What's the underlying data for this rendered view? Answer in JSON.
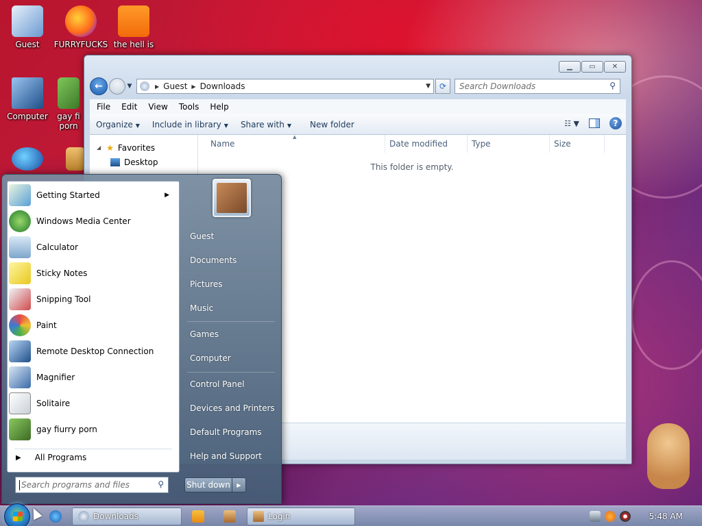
{
  "desktop": {
    "icons": [
      {
        "label": "Guest"
      },
      {
        "label": "FURRYFUCKS"
      },
      {
        "label": "the hell is"
      },
      {
        "label": "Computer"
      },
      {
        "label": "gay fi"
      },
      {
        "label": "porn"
      }
    ]
  },
  "explorer": {
    "breadcrumb": [
      "Guest",
      "Downloads"
    ],
    "search_placeholder": "Search Downloads",
    "menu": [
      "File",
      "Edit",
      "View",
      "Tools",
      "Help"
    ],
    "commands": {
      "organize": "Organize",
      "include_in_library": "Include in library",
      "share_with": "Share with",
      "new_folder": "New folder"
    },
    "nav": {
      "favorites": "Favorites",
      "desktop": "Desktop"
    },
    "columns": [
      "Name",
      "Date modified",
      "Type",
      "Size"
    ],
    "empty_message": "This folder is empty."
  },
  "start_menu": {
    "programs": [
      {
        "label": "Getting Started",
        "icon": "getting-started-icon"
      },
      {
        "label": "Windows Media Center",
        "icon": "media-center-icon"
      },
      {
        "label": "Calculator",
        "icon": "calculator-icon"
      },
      {
        "label": "Sticky Notes",
        "icon": "sticky-notes-icon"
      },
      {
        "label": "Snipping Tool",
        "icon": "snipping-tool-icon"
      },
      {
        "label": "Paint",
        "icon": "paint-icon"
      },
      {
        "label": "Remote Desktop Connection",
        "icon": "remote-desktop-icon"
      },
      {
        "label": "Magnifier",
        "icon": "magnifier-icon"
      },
      {
        "label": "Solitaire",
        "icon": "solitaire-icon"
      },
      {
        "label": "gay fiurry porn",
        "icon": "bear-icon"
      }
    ],
    "all_programs": "All Programs",
    "search_placeholder": "Search programs and files",
    "right_links": [
      "Guest",
      "Documents",
      "Pictures",
      "Music",
      "Games",
      "Computer",
      "Control Panel",
      "Devices and Printers",
      "Default Programs",
      "Help and Support"
    ],
    "shutdown": "Shut down"
  },
  "taskbar": {
    "downloads": "Downloads",
    "login": "Login",
    "clock": "5:48 AM"
  }
}
